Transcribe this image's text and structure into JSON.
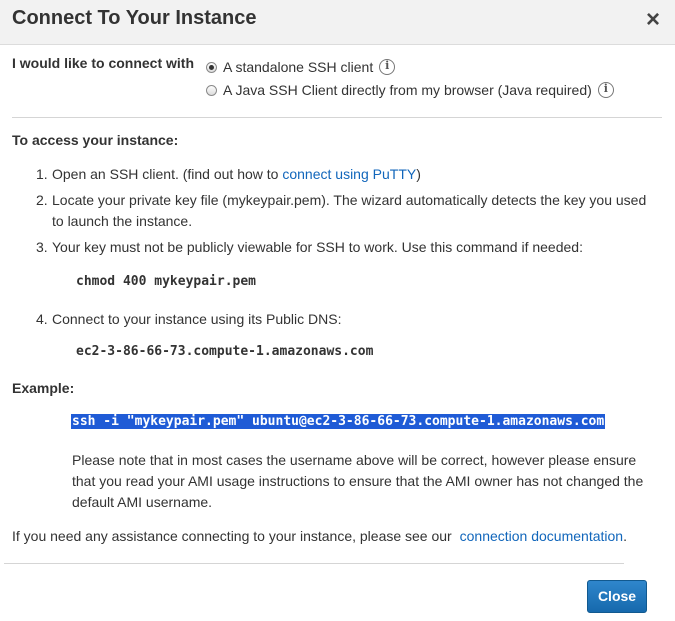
{
  "dialog": {
    "title": "Connect To Your Instance",
    "close_icon": "×"
  },
  "connect_with": {
    "label": "I would like to connect with",
    "options": [
      {
        "label": "A standalone SSH client",
        "selected": true
      },
      {
        "label": "A Java SSH Client directly from my browser (Java required)",
        "selected": false
      }
    ]
  },
  "access": {
    "title": "To access your instance:",
    "steps": [
      {
        "num": "1.",
        "text_before": "Open an SSH client. (find out how to",
        "link": "connect using PuTTY",
        "text_after": ")"
      },
      {
        "num": "2.",
        "text": "Locate your private key file (mykeypair.pem). The wizard automatically detects the key you used to launch the instance."
      },
      {
        "num": "3.",
        "text": "Your key must not be publicly viewable for SSH to work. Use this command if needed:"
      },
      {
        "num": "4.",
        "text": "Connect to your instance using its Public DNS:"
      }
    ],
    "chmod_command": "chmod 400 mykeypair.pem",
    "public_dns": "ec2-3-86-66-73.compute-1.amazonaws.com"
  },
  "example": {
    "title": "Example:",
    "command": "ssh -i \"mykeypair.pem\" ubuntu@ec2-3-86-66-73.compute-1.amazonaws.com",
    "note": "Please note that in most cases the username above will be correct, however please ensure that you read your AMI usage instructions to ensure that the AMI owner has not changed the default AMI username."
  },
  "footer": {
    "help_text": "If you need any assistance connecting to your instance, please see our",
    "help_link": "connection documentation",
    "help_after": ".",
    "close_button": "Close"
  },
  "colors": {
    "link": "#1166bb",
    "button": "#1a73b8",
    "selection": "#1f5bd6"
  }
}
